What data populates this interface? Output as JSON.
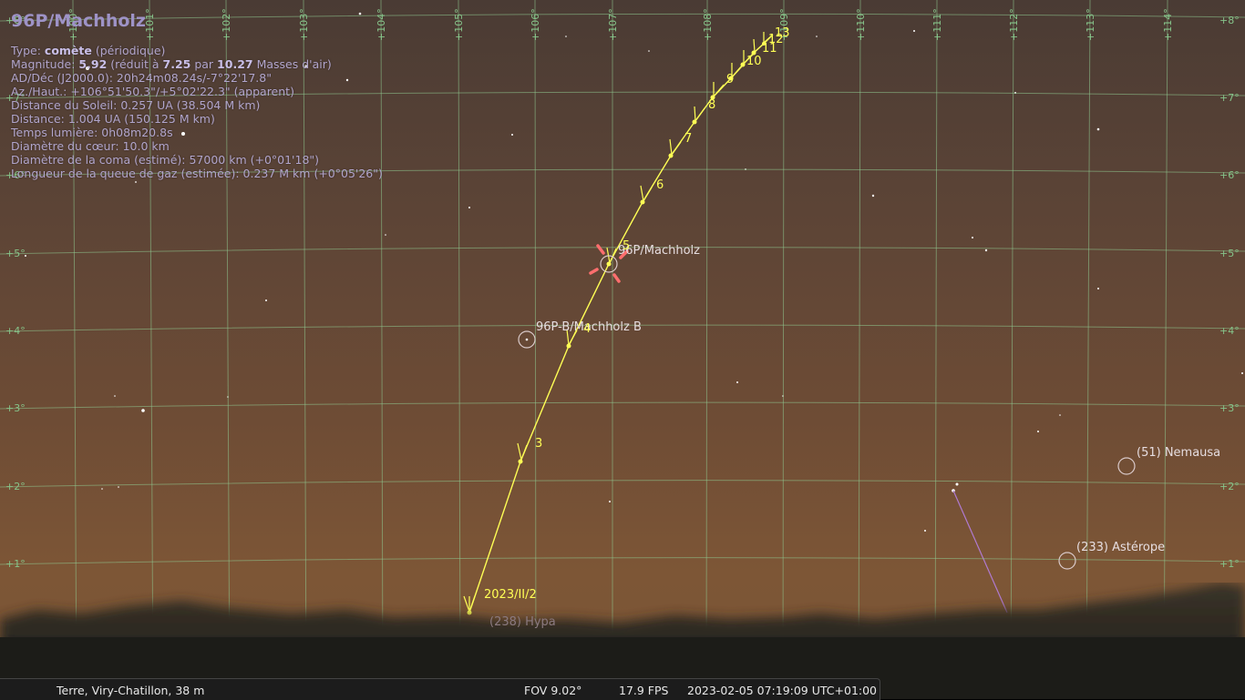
{
  "object": {
    "title": "96P/Machholz",
    "type_prefix": "Type: ",
    "type_value": "comète",
    "type_suffix": " (périodique)",
    "mag_prefix": "Magnitude: ",
    "mag_value": "5.92",
    "mag_mid1": " (réduit à ",
    "mag_reduced": "7.25",
    "mag_mid2": " par ",
    "mag_airmass": "10.27",
    "mag_suffix": " Masses d'air)",
    "radec": "AD/Déc (J2000.0): 20h24m08.24s/-7°22'17.8\"",
    "azalt": "Az./Haut.: +106°51'50.3\"/+5°02'22.3\" (apparent)",
    "dist_sun": "Distance du Soleil: 0.257 UA (38.504 M km)",
    "distance": "Distance: 1.004 UA (150.125 M km)",
    "light_time": "Temps lumière: 0h08m20.8s",
    "nucleus": "Diamètre du cœur: 10.0 km",
    "coma": "Diamètre de la coma (estimé): 57000 km (+0°01'18\")",
    "tail": "Longueur de la queue de gaz (estimée): 0.237 M km (+0°05'26\")"
  },
  "grid": {
    "az_labels": [
      "+100°",
      "+101°",
      "+102°",
      "+103°",
      "+104°",
      "+105°",
      "+106°",
      "+107°",
      "+108°",
      "+109°",
      "+110°",
      "+111°",
      "+112°",
      "+113°",
      "+114°"
    ],
    "alt_labels": [
      "+8°",
      "+7°",
      "+6°",
      "+5°",
      "+4°",
      "+3°",
      "+2°",
      "+1°"
    ],
    "color": "#86c48a"
  },
  "trail": {
    "start_label": "2023/II/2",
    "tick_labels": [
      "3",
      "4",
      "5",
      "6",
      "7",
      "8",
      "9",
      "10",
      "11",
      "12",
      "13"
    ],
    "color": "#ffff55"
  },
  "sky_labels": {
    "comet": "96P/Machholz",
    "comet_b": "96P-B/Machholz B",
    "nemausa": "(51) Nemausa",
    "asterope": "(233) Astérope",
    "hidden": "(238) Hypa"
  },
  "status_bar": {
    "location": "Terre, Viry-Chatillon, 38 m",
    "fov": "FOV 9.02°",
    "fps": "17.9 FPS",
    "datetime": "2023-02-05 07:19:09 UTC+01:00"
  }
}
